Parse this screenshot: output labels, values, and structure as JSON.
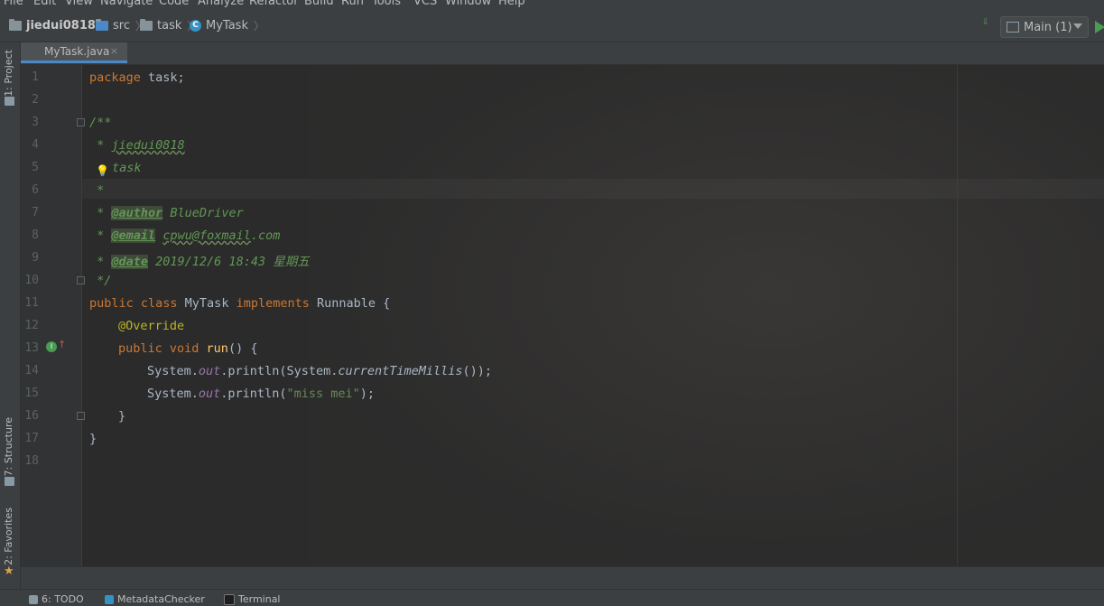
{
  "menu": [
    "File",
    "Edit",
    "View",
    "Navigate",
    "Code",
    "Analyze",
    "Refactor",
    "Build",
    "Run",
    "Tools",
    "VCS",
    "Window",
    "Help"
  ],
  "breadcrumb": {
    "project": "jiedui0818",
    "src": "src",
    "package": "task",
    "class": "MyTask"
  },
  "run_config": {
    "label": "Main (1)"
  },
  "left_tools": {
    "project": "1: Project",
    "structure": "7: Structure",
    "favorites": "2: Favorites"
  },
  "editor_tab": {
    "label": "MyTask.java",
    "close": "×"
  },
  "line_numbers": [
    "1",
    "2",
    "3",
    "4",
    "5",
    "6",
    "7",
    "8",
    "9",
    "10",
    "11",
    "12",
    "13",
    "14",
    "15",
    "16",
    "17",
    "18"
  ],
  "code": {
    "l1_kw": "package",
    "l1_rest": " task;",
    "l3": "/**",
    "l4_prefix": " * ",
    "l4_name": "jiedui0818",
    "l5": "task",
    "l6": " *",
    "l7_prefix": " * ",
    "l7_tag": "@author",
    "l7_val": " BlueDriver",
    "l8_prefix": " * ",
    "l8_tag": "@email",
    "l8_val": "cpwu@foxmail",
    "l8_tail": ".com",
    "l9_prefix": " * ",
    "l9_tag": "@date",
    "l9_val": " 2019/12/6 18:43 星期五",
    "l10": " */",
    "l11_kw1": "public class",
    "l11_name": " MyTask ",
    "l11_kw2": "implements",
    "l11_rest": " Runnable {",
    "l12_ann": "@Override",
    "l13_kw": "public void",
    "l13_fn": "run",
    "l13_rest": "() {",
    "l14_a": "System.",
    "l14_out": "out",
    "l14_b": ".println(System.",
    "l14_call": "currentTimeMillis",
    "l14_c": "());",
    "l15_a": "System.",
    "l15_out": "out",
    "l15_b": ".println(",
    "l15_str": "\"miss mei\"",
    "l15_c": ");",
    "l16": "}",
    "l17": "}"
  },
  "bottom_tools": {
    "todo": "6: TODO",
    "metadata": "MetadataChecker",
    "terminal": "Terminal"
  },
  "colors": {
    "background": "#2b2b2b",
    "keyword": "#cc7832",
    "comment": "#629755",
    "annotation": "#bbb529",
    "function": "#ffc66d",
    "static_field": "#9876aa",
    "string": "#6a8759",
    "accent": "#4a88c7"
  },
  "icons": [
    "folder-icon",
    "class-icon",
    "build-icon",
    "run-icon",
    "lightbulb-icon",
    "override-icon",
    "star-icon",
    "close-icon"
  ]
}
